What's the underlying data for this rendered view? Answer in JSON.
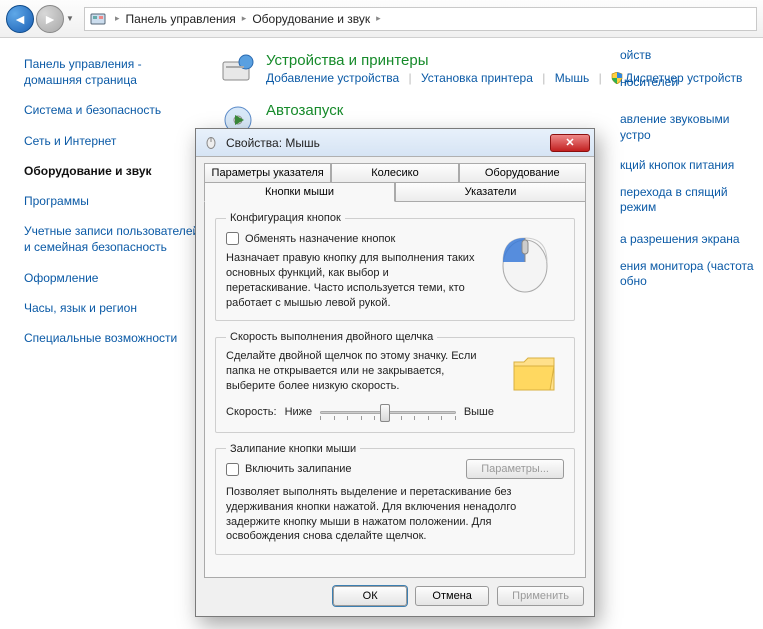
{
  "breadcrumb": {
    "part1": "Панель управления",
    "part2": "Оборудование и звук"
  },
  "sidebar": {
    "items": [
      {
        "label": "Панель управления - домашняя страница"
      },
      {
        "label": "Система и безопасность"
      },
      {
        "label": "Сеть и Интернет"
      },
      {
        "label": "Оборудование и звук"
      },
      {
        "label": "Программы"
      },
      {
        "label": "Учетные записи пользователей и семейная безопасность"
      },
      {
        "label": "Оформление"
      },
      {
        "label": "Часы, язык и регион"
      },
      {
        "label": "Специальные возможности"
      }
    ]
  },
  "categories": {
    "devices": {
      "title": "Устройства и принтеры",
      "links": [
        "Добавление устройства",
        "Установка принтера",
        "Мышь",
        "Диспетчер устройств"
      ]
    },
    "autoplay": {
      "title": "Автозапуск"
    }
  },
  "bg_links": {
    "r1a": "ойств",
    "r1b": "носителей",
    "r2a": "авление звуковыми устро",
    "r3a": "кций кнопок питания",
    "r3b": "перехода в спящий режим",
    "r4a": "а разрешения экрана",
    "r4b": "ения монитора (частота обно"
  },
  "dialog": {
    "title": "Свойства: Мышь",
    "tabs": {
      "pointer_opts": "Параметры указателя",
      "wheel": "Колесико",
      "hardware": "Оборудование",
      "buttons": "Кнопки мыши",
      "pointers": "Указатели"
    },
    "group_buttons": {
      "legend": "Конфигурация кнопок",
      "swap_label": "Обменять назначение кнопок",
      "desc": "Назначает правую кнопку для выполнения таких основных функций, как выбор и перетаскивание. Часто используется теми, кто работает с мышью левой рукой."
    },
    "group_speed": {
      "legend": "Скорость выполнения двойного щелчка",
      "desc": "Сделайте двойной щелчок по этому значку. Если папка не открывается или не закрывается, выберите более низкую скорость.",
      "label_speed": "Скорость:",
      "label_low": "Ниже",
      "label_high": "Выше"
    },
    "group_clicklock": {
      "legend": "Залипание кнопки мыши",
      "enable_label": "Включить залипание",
      "params_btn": "Параметры...",
      "desc": "Позволяет выполнять выделение и перетаскивание без удерживания кнопки нажатой. Для включения ненадолго задержите кнопку мыши в нажатом положении. Для освобождения снова сделайте щелчок."
    },
    "buttons": {
      "ok": "ОК",
      "cancel": "Отмена",
      "apply": "Применить"
    }
  }
}
